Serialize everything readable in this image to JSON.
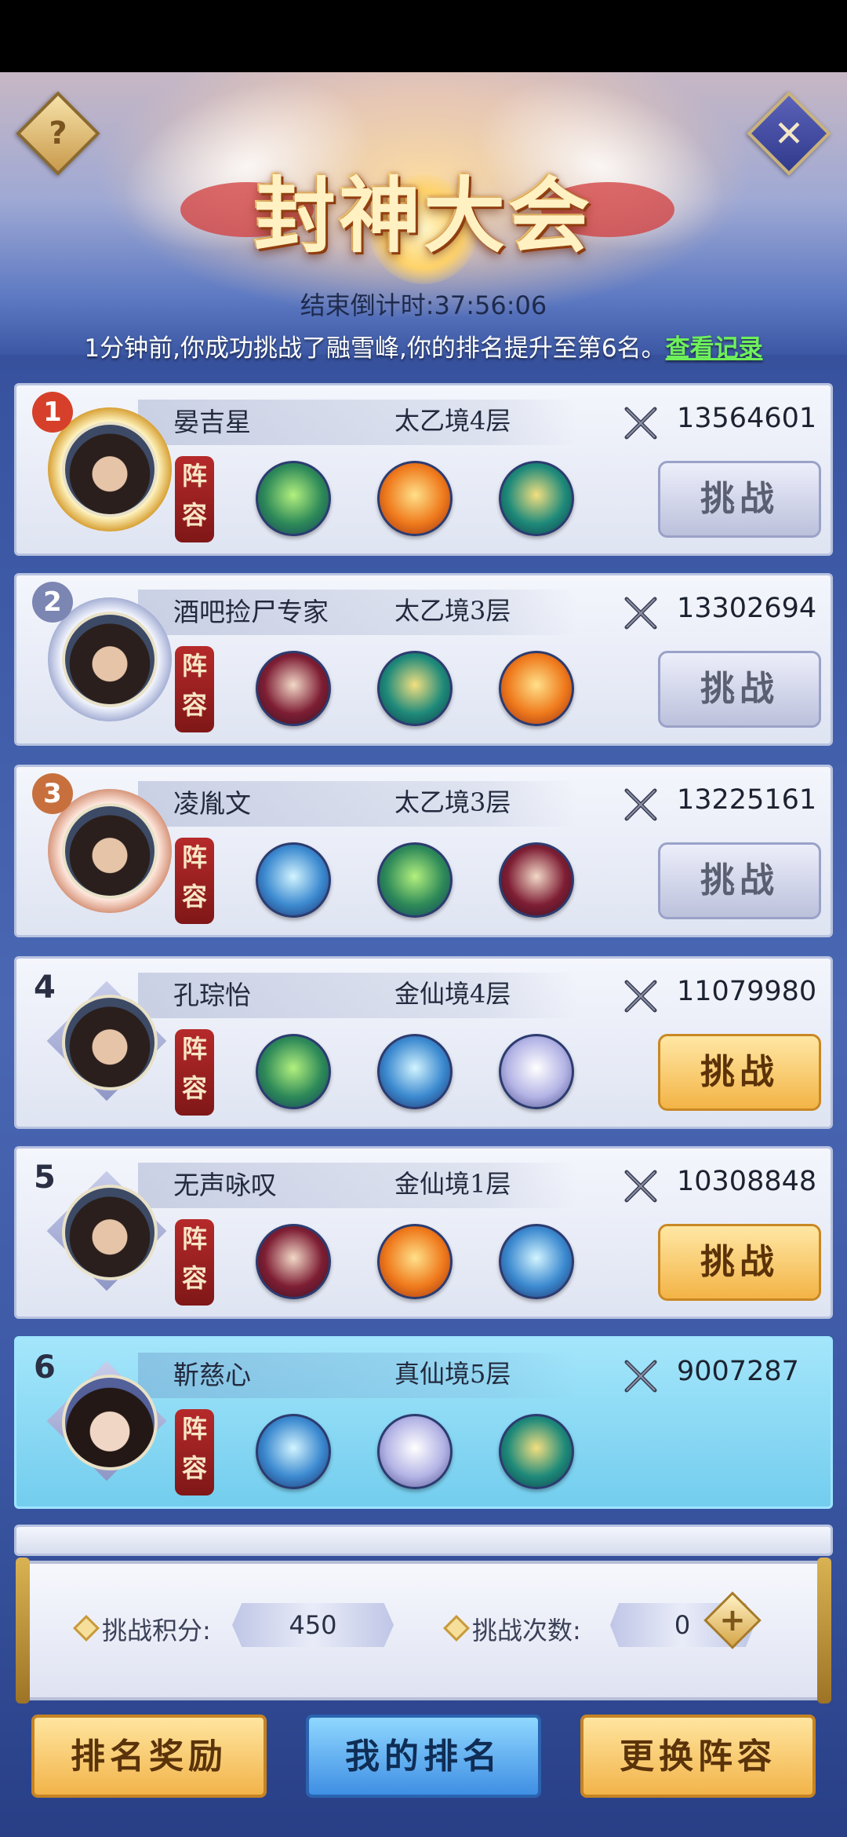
{
  "header": {
    "title": "封神大会",
    "countdown": "结束倒计时:37:56:06",
    "notice": "1分钟前,你成功挑战了融雪峰,你的排名提升至第6名。",
    "view_records": "查看记录",
    "help_label": "?",
    "close_label": "✕"
  },
  "labels": {
    "lineup": "阵容",
    "challenge": "挑战"
  },
  "players": [
    {
      "rank": "1",
      "name": "晏吉星",
      "realm": "太乙境4层",
      "power": "13564601",
      "pets": [
        "green",
        "orange",
        "teal"
      ],
      "can_challenge": false
    },
    {
      "rank": "2",
      "name": "酒吧捡尸专家",
      "realm": "太乙境3层",
      "power": "13302694",
      "pets": [
        "crimson",
        "teal",
        "orange"
      ],
      "can_challenge": false
    },
    {
      "rank": "3",
      "name": "凌胤文",
      "realm": "太乙境3层",
      "power": "13225161",
      "pets": [
        "blue",
        "green",
        "crimson"
      ],
      "can_challenge": false
    },
    {
      "rank": "4",
      "name": "孔琮怡",
      "realm": "金仙境4层",
      "power": "11079980",
      "pets": [
        "green",
        "blue",
        "white"
      ],
      "can_challenge": true
    },
    {
      "rank": "5",
      "name": "无声咏叹",
      "realm": "金仙境1层",
      "power": "10308848",
      "pets": [
        "crimson",
        "orange",
        "blue"
      ],
      "can_challenge": true
    },
    {
      "rank": "6",
      "name": "靳慈心",
      "realm": "真仙境5层",
      "power": "9007287",
      "pets": [
        "blue",
        "white",
        "teal"
      ],
      "can_challenge": false,
      "is_self": true
    }
  ],
  "stats": {
    "score_label": "挑战积分:",
    "score_value": "450",
    "attempts_label": "挑战次数:",
    "attempts_value": "0",
    "add_label": "+"
  },
  "buttons": {
    "rewards": "排名奖励",
    "my_rank": "我的排名",
    "change_lineup": "更换阵容"
  },
  "colors": {
    "accent_link": "#6ef05a",
    "gold_button": "#f2b44a",
    "self_highlight": "#8fd9f5",
    "lineup_tag": "#9b2020"
  }
}
